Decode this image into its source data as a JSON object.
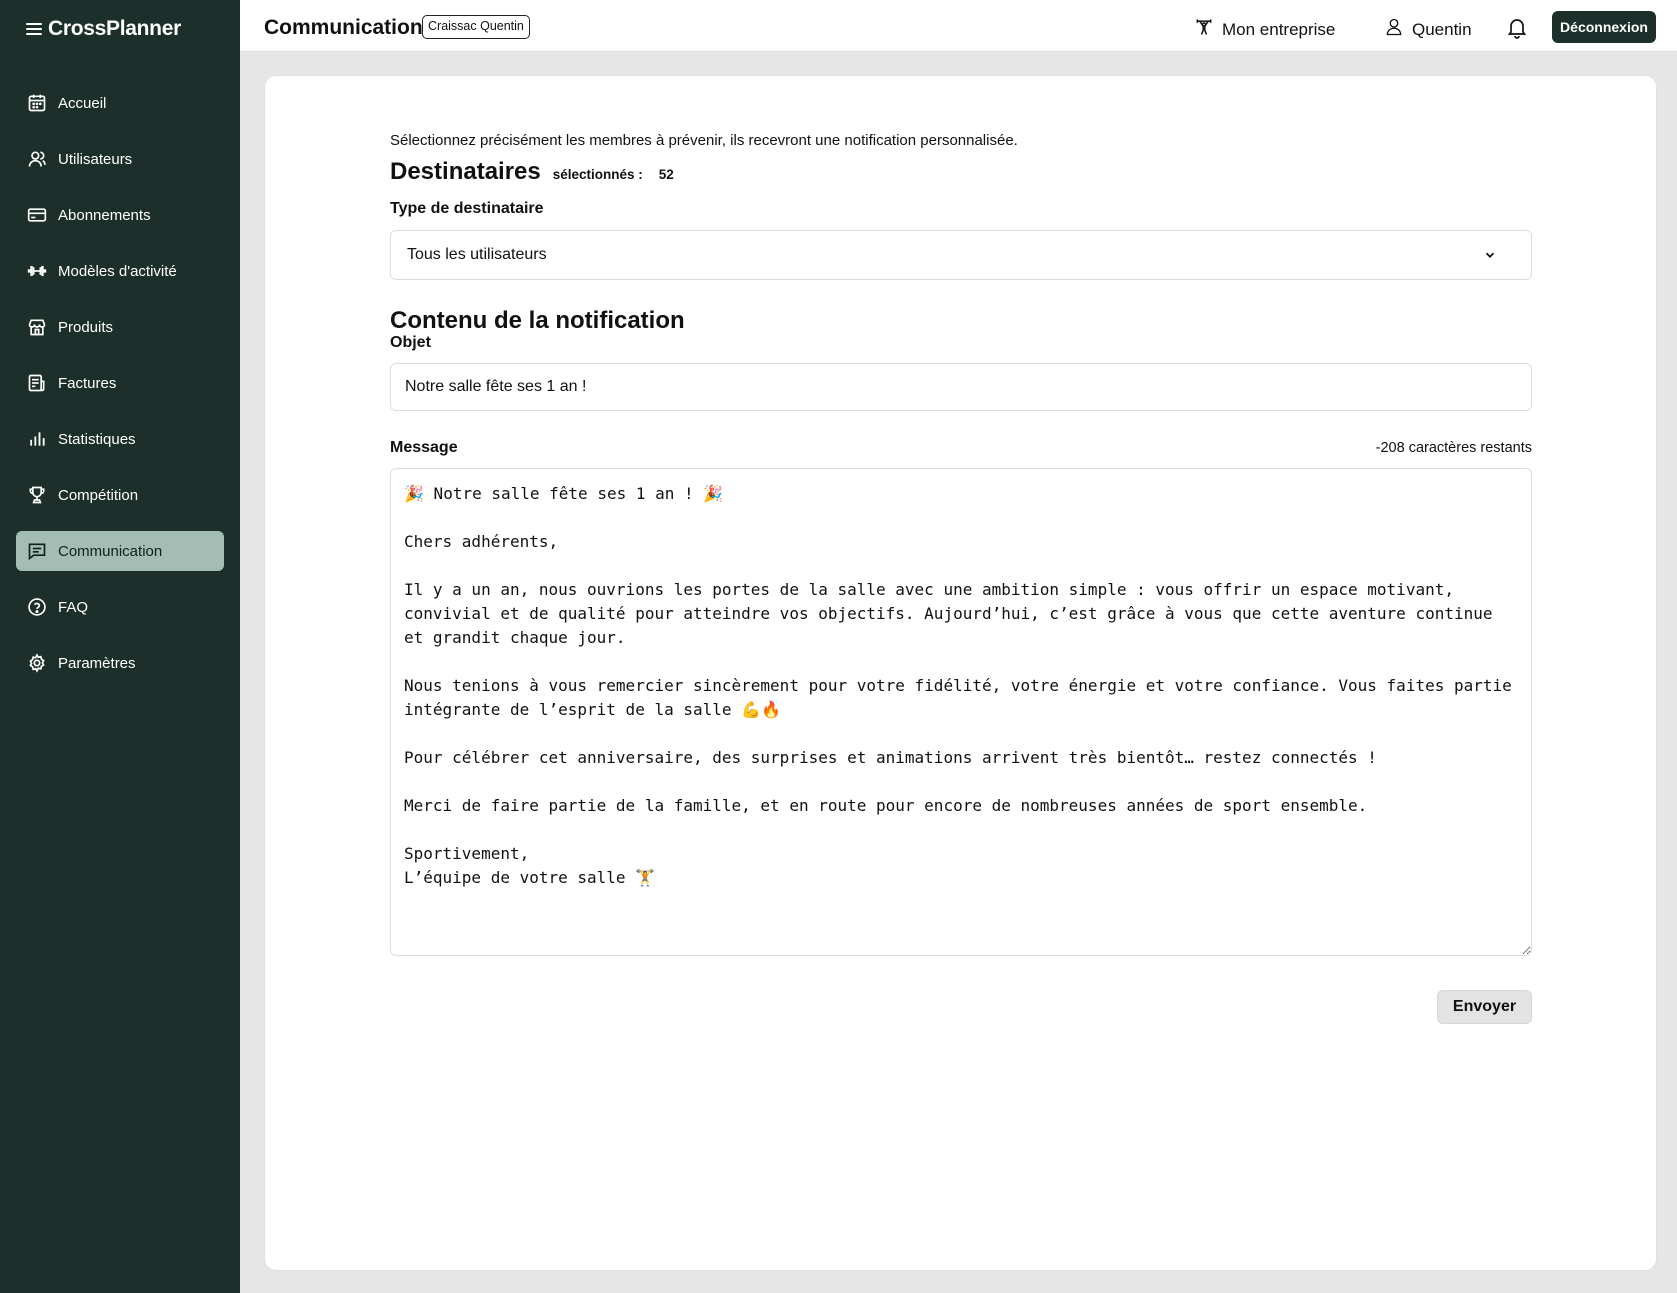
{
  "brand": {
    "name": "CrossPlanner"
  },
  "sidebar": {
    "items": [
      {
        "label": "Accueil",
        "icon": "calendar-icon"
      },
      {
        "label": "Utilisateurs",
        "icon": "users-icon"
      },
      {
        "label": "Abonnements",
        "icon": "credit-card-icon"
      },
      {
        "label": "Modèles d'activité",
        "icon": "dumbbell-icon"
      },
      {
        "label": "Produits",
        "icon": "store-icon"
      },
      {
        "label": "Factures",
        "icon": "invoice-icon"
      },
      {
        "label": "Statistiques",
        "icon": "bar-chart-icon"
      },
      {
        "label": "Compétition",
        "icon": "trophy-icon"
      },
      {
        "label": "Communication",
        "icon": "message-icon",
        "active": true
      },
      {
        "label": "FAQ",
        "icon": "help-circle-icon"
      },
      {
        "label": "Paramètres",
        "icon": "gear-icon"
      }
    ]
  },
  "header": {
    "title": "Communication",
    "user_chip": "Craissac Quentin",
    "company_label": "Mon entreprise",
    "profile_label": "Quentin",
    "logout_label": "Déconnexion"
  },
  "main": {
    "intro": "Sélectionnez précisément les membres à prévenir, ils recevront une notification personnalisée.",
    "recipients_title": "Destinataires",
    "selected_label": "sélectionnés :",
    "selected_count": "52",
    "recipient_type_label": "Type de destinataire",
    "recipient_type_value": "Tous les utilisateurs",
    "content_title": "Contenu de la notification",
    "subject_label": "Objet",
    "subject_value": "Notre salle fête ses 1 an !",
    "message_label": "Message",
    "remaining_chars": "-208 caractères restants",
    "message_value": "🎉 Notre salle fête ses 1 an ! 🎉\n\nChers adhérents,\n\nIl y a un an, nous ouvrions les portes de la salle avec une ambition simple : vous offrir un espace motivant,\nconvivial et de qualité pour atteindre vos objectifs. Aujourd’hui, c’est grâce à vous que cette aventure continue\net grandit chaque jour.\n\nNous tenions à vous remercier sincèrement pour votre fidélité, votre énergie et votre confiance. Vous faites partie\nintégrante de l’esprit de la salle 💪🔥\n\nPour célébrer cet anniversaire, des surprises et animations arrivent très bientôt… restez connectés !\n\nMerci de faire partie de la famille, et en route pour encore de nombreuses années de sport ensemble.\n\nSportivement,\nL’équipe de votre salle 🏋",
    "send_label": "Envoyer"
  }
}
